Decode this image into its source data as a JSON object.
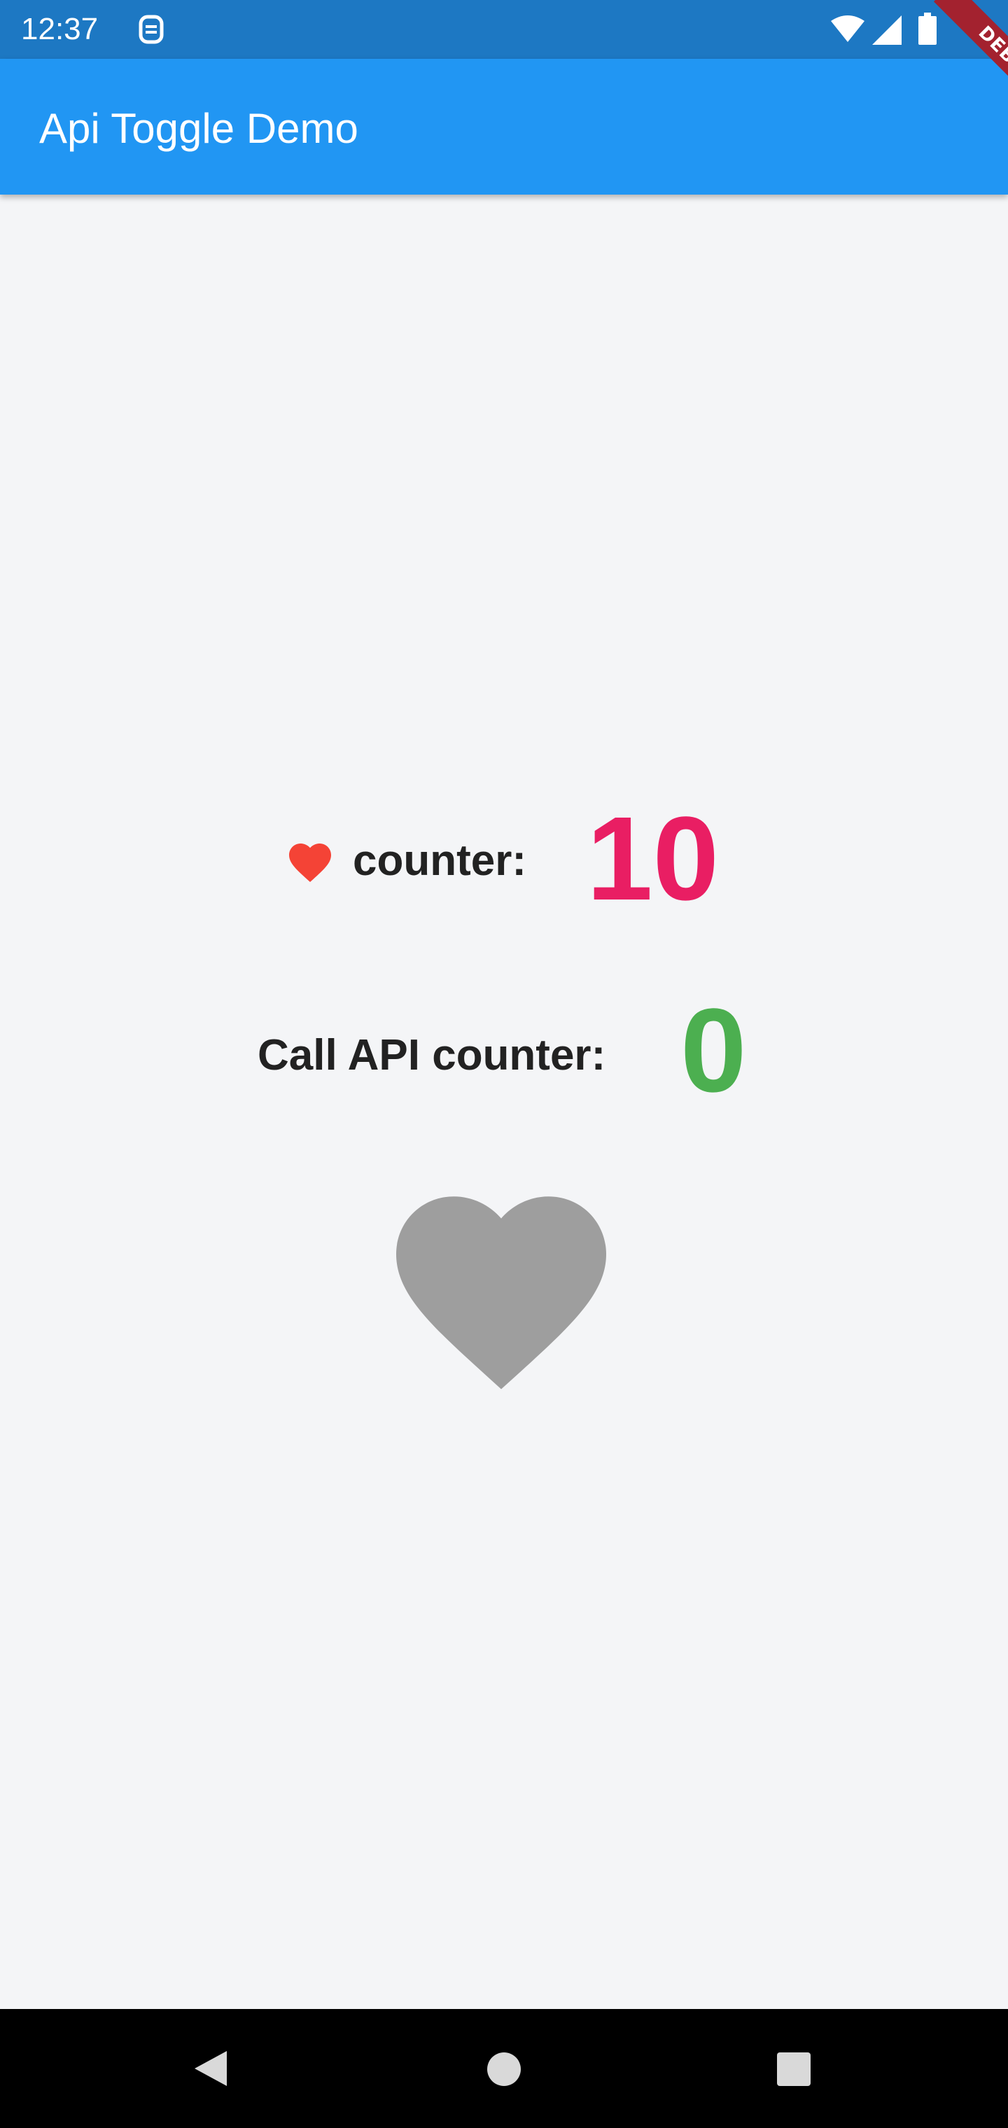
{
  "status_bar": {
    "time": "12:37",
    "icons": [
      "notification-icon",
      "wifi-icon",
      "signal-icon",
      "battery-icon"
    ]
  },
  "app_bar": {
    "title": "Api Toggle Demo"
  },
  "debug_banner": {
    "text": "DEBUG"
  },
  "main": {
    "heart_counter": {
      "icon": "heart-icon",
      "label": "counter:",
      "value": "10"
    },
    "api_counter": {
      "label": "Call API counter:",
      "value": "0"
    },
    "toggle_button": {
      "icon": "heart-icon",
      "state": "off"
    }
  },
  "nav_bar": {
    "icons": [
      "back-icon",
      "home-icon",
      "recents-icon"
    ]
  },
  "colors": {
    "status_bar": "#1d78c3",
    "app_bar": "#2196f3",
    "heart_counter_value": "#e91e63",
    "api_counter_value": "#4caf50",
    "small_heart": "#f44336",
    "big_heart_inactive": "#9e9e9e",
    "label_text": "#222222",
    "nav_bar": "#000000"
  }
}
